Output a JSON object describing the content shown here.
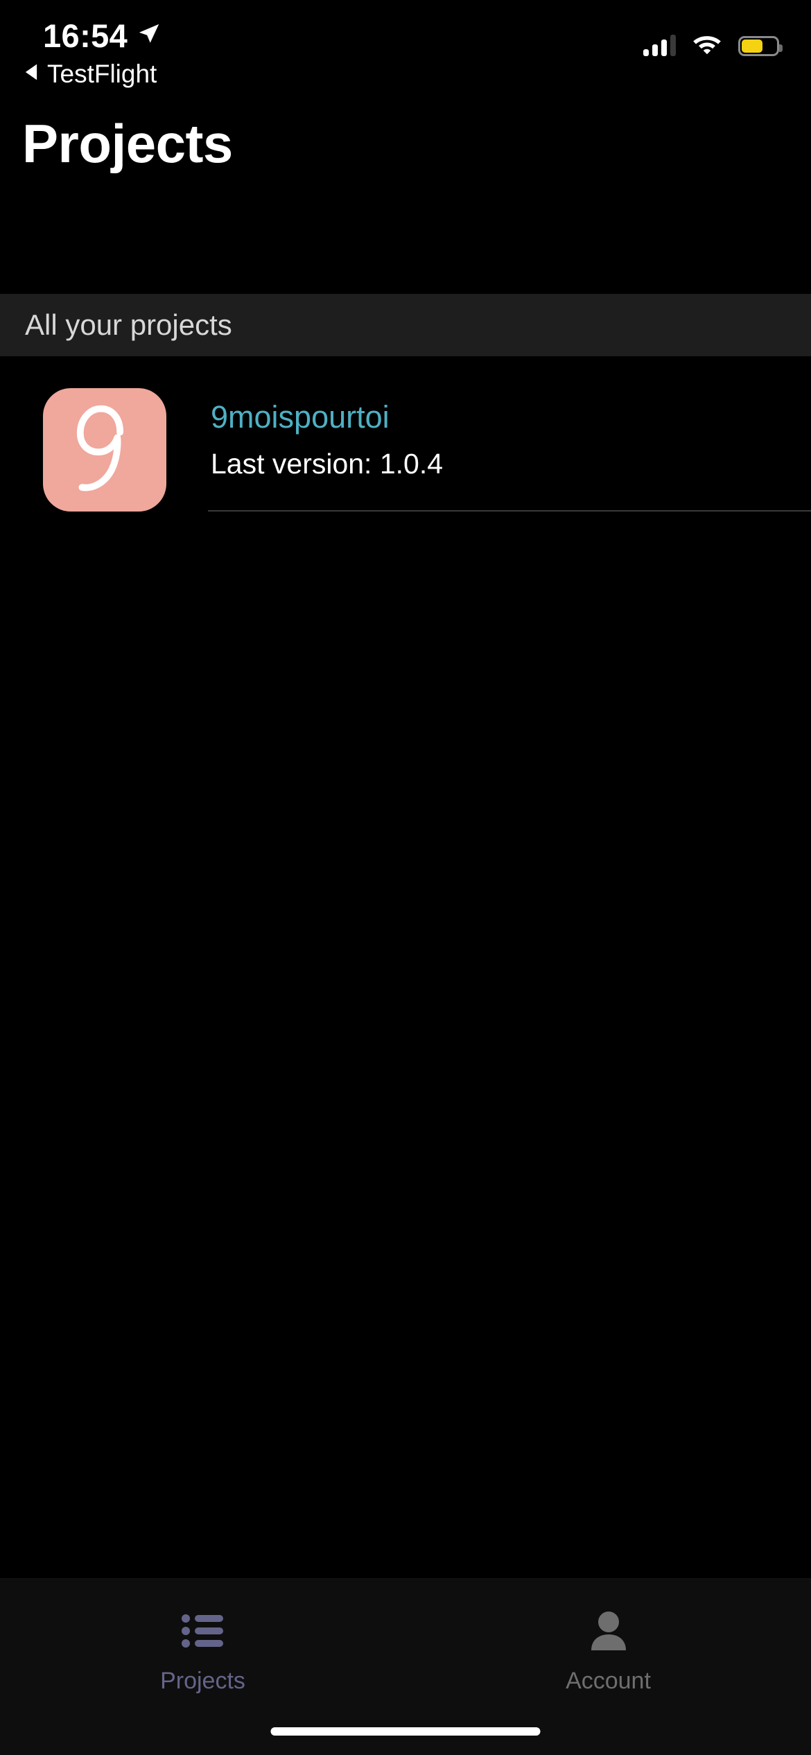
{
  "status_bar": {
    "time": "16:54",
    "location_icon": "location-arrow-icon",
    "back_caret_icon": "back-caret-icon",
    "back_app_label": "TestFlight",
    "cellular_icon": "cellular-signal-icon",
    "cellular_bars_filled": 3,
    "cellular_bars_total": 4,
    "wifi_icon": "wifi-icon",
    "battery_icon": "battery-icon",
    "battery_level_percent": 62,
    "battery_color": "#F5D312"
  },
  "header": {
    "title": "Projects"
  },
  "section": {
    "header_label": "All your projects",
    "background": "#1E1E1E"
  },
  "projects": [
    {
      "icon_name": "9moispourtoi-app-icon",
      "icon_background": "#F0A79C",
      "icon_glyph": "script-nine-glyph",
      "name": "9moispourtoi",
      "name_color": "#4FB0C4",
      "version_label": "Last version: 1.0.4"
    }
  ],
  "tab_bar": {
    "background": "#0E0E0E",
    "tabs": [
      {
        "id": "projects",
        "label": "Projects",
        "icon": "bulleted-list-icon",
        "color": "#64648A",
        "selected": true
      },
      {
        "id": "account",
        "label": "Account",
        "icon": "person-icon",
        "color": "#6E6E6E",
        "selected": false
      }
    ]
  },
  "home_indicator": {
    "name": "home-indicator"
  }
}
